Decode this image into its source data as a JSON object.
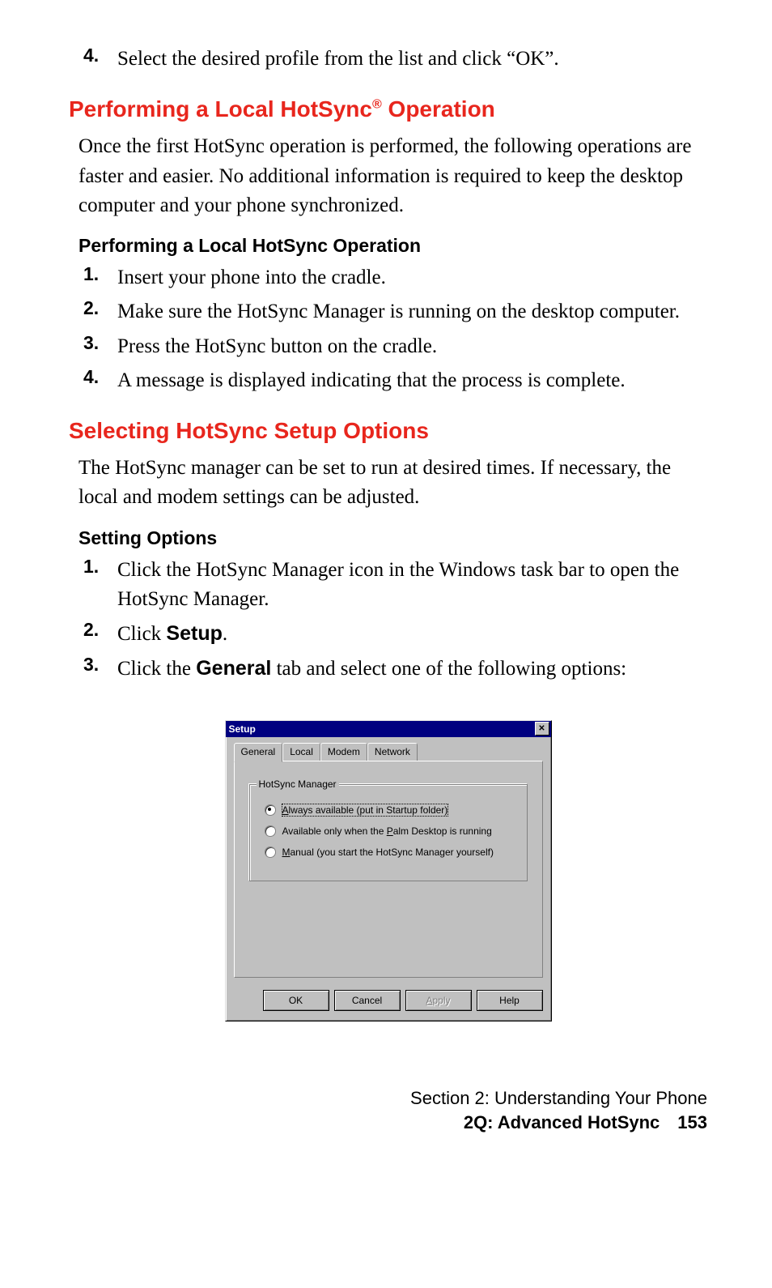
{
  "top_list": {
    "num": "4.",
    "text": "Select the desired profile from the list and click “OK”."
  },
  "heading1_pre": "Performing a Local HotSync",
  "heading1_sup": "®",
  "heading1_post": " Operation",
  "para1": "Once the first HotSync operation is performed, the following operations are faster and easier. No additional information is required to keep the desktop computer and your phone synchronized.",
  "sub1": "Performing a Local HotSync Operation",
  "steps1": [
    {
      "num": "1.",
      "text": "Insert your phone into the cradle."
    },
    {
      "num": "2.",
      "text": "Make sure the HotSync Manager is running on the desktop computer."
    },
    {
      "num": "3.",
      "text": "Press the HotSync button on the cradle."
    },
    {
      "num": "4.",
      "text": "A message is displayed indicating that the process is complete."
    }
  ],
  "heading2": "Selecting HotSync Setup Options",
  "para2": "The HotSync manager can be set to run at desired times. If necessary, the local and modem settings can be adjusted.",
  "sub2": "Setting Options",
  "steps2": [
    {
      "num": "1.",
      "text": "Click the HotSync Manager icon in the Windows task bar to open the HotSync Manager."
    },
    {
      "num": "2.",
      "pre": "Click ",
      "bold": "Setup",
      "post": "."
    },
    {
      "num": "3.",
      "pre": "Click the ",
      "bold": "General",
      "post": " tab and select one of the following options:"
    }
  ],
  "dialog": {
    "title": "Setup",
    "close": "✕",
    "tabs": [
      "General",
      "Local",
      "Modem",
      "Network"
    ],
    "group_label": "HotSync Manager",
    "radios": [
      {
        "u": "A",
        "rest": "lways available (put in Startup folder)",
        "checked": true
      },
      {
        "pre": "Available only when the ",
        "u": "P",
        "rest": "alm Desktop is running",
        "checked": false
      },
      {
        "u": "M",
        "rest": "anual (you start the HotSync Manager yourself)",
        "checked": false
      }
    ],
    "buttons": {
      "ok": "OK",
      "cancel": "Cancel",
      "apply_u": "A",
      "apply_rest": "pply",
      "help": "Help"
    }
  },
  "footer": {
    "line1": "Section 2: Understanding Your Phone",
    "line2": "2Q: Advanced HotSync 153"
  }
}
